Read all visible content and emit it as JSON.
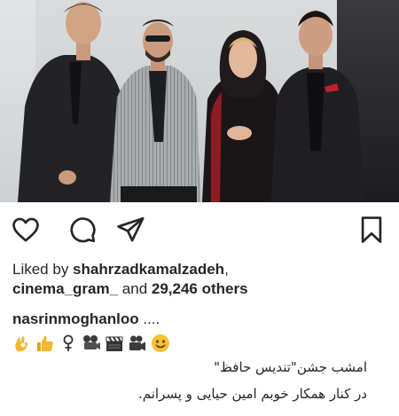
{
  "post": {
    "photo_alt": "Four people posing together in front of a light grey wall",
    "likes": {
      "prefix": "Liked by ",
      "user1": "shahrzadkamalzadeh",
      "sep1": ",",
      "user2": "cinema_gram_",
      "middle": " and ",
      "count": "29,246 others"
    },
    "caption": {
      "username": "nasrinmoghanloo",
      "dots": " ....",
      "emojis": [
        "ok-hand",
        "thumbs-up",
        "female-sign",
        "film-projector",
        "clapper-board",
        "movie-camera",
        "smiling-face"
      ],
      "line1": "امشب جشن\"تندیس حافظ\"",
      "line2": "در کنار همکار خوبم امین حیایی و پسرانم."
    }
  },
  "icons": {
    "like": "heart-icon",
    "comment": "comment-icon",
    "share": "send-icon",
    "save": "bookmark-icon"
  }
}
